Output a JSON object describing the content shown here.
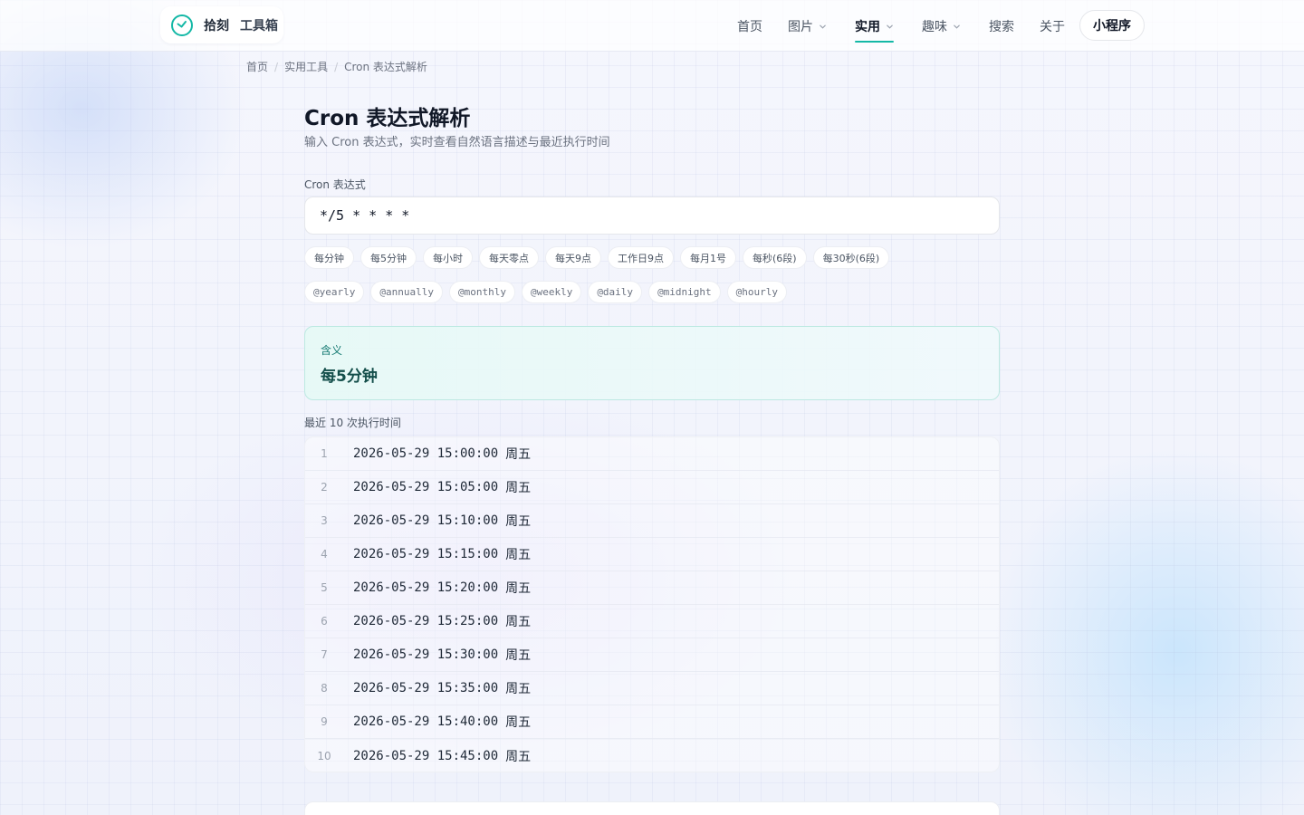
{
  "header": {
    "logo_name": "拾刻",
    "logo_sub": "工具箱",
    "nav": [
      {
        "label": "首页"
      },
      {
        "label": "图片"
      },
      {
        "label": "实用"
      },
      {
        "label": "趣味"
      },
      {
        "label": "搜索"
      },
      {
        "label": "关于"
      }
    ],
    "mini_program": "小程序",
    "accent_color": "#14b8a6"
  },
  "breadcrumb": [
    "首页",
    "实用工具",
    "Cron 表达式解析"
  ],
  "page": {
    "title": "Cron 表达式解析",
    "subtitle": "输入 Cron 表达式，实时查看自然语言描述与最近执行时间"
  },
  "input": {
    "label": "Cron 表达式",
    "value": "*/5 * * * *"
  },
  "presets": [
    "每分钟",
    "每5分钟",
    "每小时",
    "每天零点",
    "每天9点",
    "工作日9点",
    "每月1号",
    "每秒(6段)",
    "每30秒(6段)"
  ],
  "macros": [
    "@yearly",
    "@annually",
    "@monthly",
    "@weekly",
    "@daily",
    "@midnight",
    "@hourly"
  ],
  "meaning": {
    "label": "含义",
    "value": "每5分钟"
  },
  "runs": {
    "label": "最近 10 次执行时间",
    "items": [
      {
        "index": "1",
        "time": "2026-05-29 15:00:00",
        "day": "周五"
      },
      {
        "index": "2",
        "time": "2026-05-29 15:05:00",
        "day": "周五"
      },
      {
        "index": "3",
        "time": "2026-05-29 15:10:00",
        "day": "周五"
      },
      {
        "index": "4",
        "time": "2026-05-29 15:15:00",
        "day": "周五"
      },
      {
        "index": "5",
        "time": "2026-05-29 15:20:00",
        "day": "周五"
      },
      {
        "index": "6",
        "time": "2026-05-29 15:25:00",
        "day": "周五"
      },
      {
        "index": "7",
        "time": "2026-05-29 15:30:00",
        "day": "周五"
      },
      {
        "index": "8",
        "time": "2026-05-29 15:35:00",
        "day": "周五"
      },
      {
        "index": "9",
        "time": "2026-05-29 15:40:00",
        "day": "周五"
      },
      {
        "index": "10",
        "time": "2026-05-29 15:45:00",
        "day": "周五"
      }
    ]
  }
}
